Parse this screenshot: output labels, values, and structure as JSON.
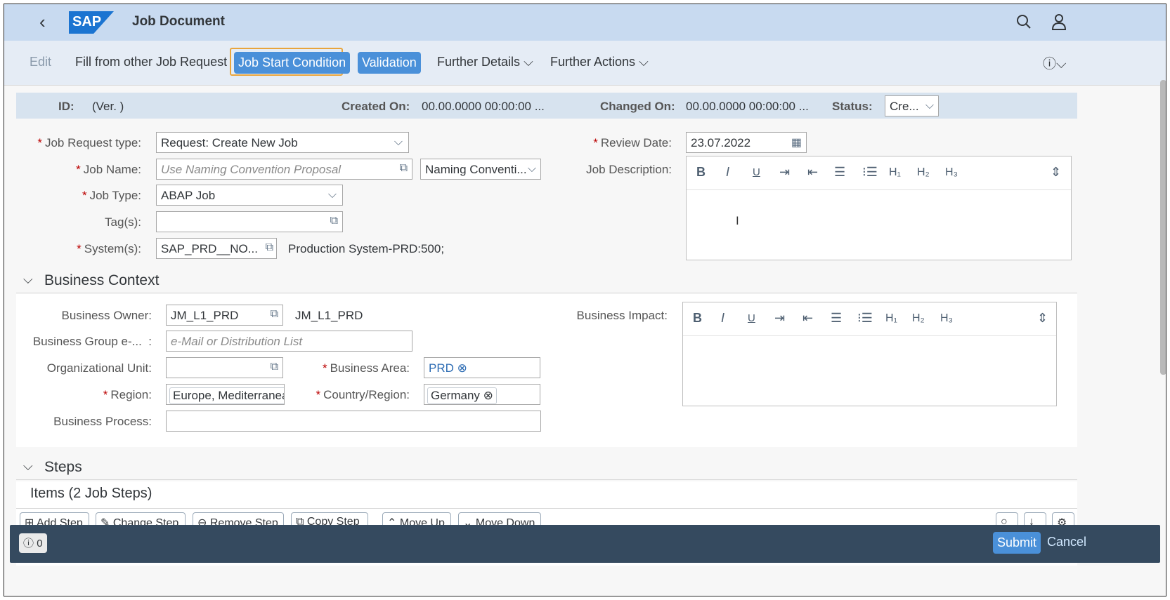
{
  "header": {
    "title": "Job Document",
    "logo": "SAP"
  },
  "toolbar": {
    "edit": "Edit",
    "fill": "Fill from other Job Request",
    "job_start": "Job Start Condition",
    "validation": "Validation",
    "further_details": "Further Details",
    "further_actions": "Further Actions"
  },
  "meta": {
    "id_label": "ID:",
    "ver": "(Ver. )",
    "created_label": "Created On:",
    "created_value": "00.00.0000 00:00:00 ...",
    "changed_label": "Changed On:",
    "changed_value": "00.00.0000 00:00:00 ...",
    "status_label": "Status:",
    "status_value": "Cre..."
  },
  "form": {
    "job_request_type_label": "Job Request type:",
    "job_request_type_value": "Request: Create New Job",
    "job_name_label": "Job Name:",
    "job_name_placeholder": "Use Naming Convention Proposal",
    "naming_convention": "Naming Conventi...",
    "job_type_label": "Job Type:",
    "job_type_value": "ABAP Job",
    "tags_label": "Tag(s):",
    "systems_label": "System(s):",
    "systems_value": "SAP_PRD__NO...",
    "systems_desc": "Production System-PRD:500;",
    "review_date_label": "Review Date:",
    "review_date_value": "23.07.2022",
    "job_description_label": "Job Description:"
  },
  "rte_buttons": [
    "B",
    "I",
    "U",
    "H₁",
    "H₂",
    "H₃"
  ],
  "business": {
    "title": "Business Context",
    "owner_label": "Business Owner:",
    "owner_value": "JM_L1_PRD",
    "owner_desc": "JM_L1_PRD",
    "group_label": "Business Group e-...",
    "group_colon": ":",
    "group_placeholder": "e-Mail or Distribution List",
    "org_label": "Organizational Unit:",
    "area_label": "Business Area:",
    "area_value": "PRD",
    "region_label": "Region:",
    "region_value": "Europe, Mediterranean",
    "country_label": "Country/Region:",
    "country_value": "Germany",
    "process_label": "Business Process:",
    "impact_label": "Business Impact:"
  },
  "steps": {
    "title": "Steps",
    "items_title": "Items (2 Job Steps)",
    "buttons": [
      "Add Step",
      "Change Step",
      "Remove Step",
      "Copy Step",
      "Move Up",
      "Move Down"
    ]
  },
  "footer": {
    "count": "0",
    "submit": "Submit",
    "cancel": "Cancel"
  }
}
